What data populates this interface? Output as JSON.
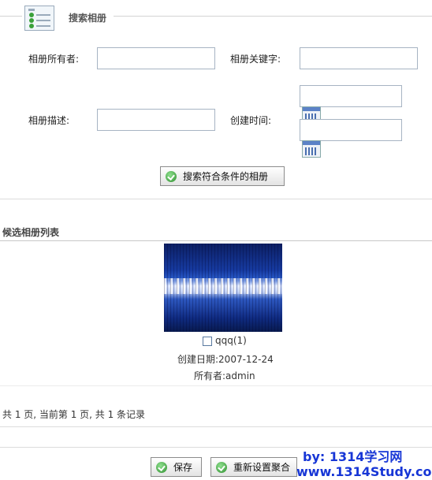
{
  "header": {
    "title": "搜索相册"
  },
  "search_form": {
    "owner_label": "相册所有者:",
    "owner_value": "",
    "keyword_label": "相册关键字:",
    "keyword_value": "",
    "description_label": "相册描述:",
    "description_value": "",
    "created_time_label": "创建时间:",
    "created_from_value": "",
    "created_to_value": "",
    "search_button": "搜索符合条件的相册"
  },
  "candidates": {
    "title": "候选相册列表",
    "items": [
      {
        "name": "qqq(1)",
        "created_date": "创建日期:2007-12-24",
        "owner": "所有者:admin",
        "checked": false
      }
    ]
  },
  "pagination": {
    "summary": "共 1 页, 当前第 1 页, 共 1 条记录"
  },
  "footer": {
    "save_button": "保存",
    "reset_button": "重新设置聚合"
  },
  "watermark": {
    "line1": "by: 1314学习网",
    "line2": "www.1314Study.com"
  }
}
